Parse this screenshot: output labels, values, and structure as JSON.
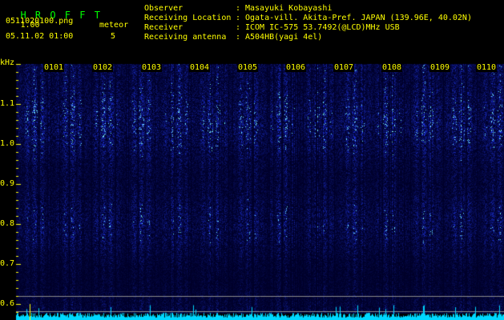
{
  "app": {
    "name": "H R O F F T",
    "version": "1.00"
  },
  "file": {
    "name": "0511020100.png",
    "datetime": "05.11.02 01:00"
  },
  "meteor": {
    "label": "meteor",
    "count": "5"
  },
  "info": [
    {
      "label": "Observer",
      "sep": ":",
      "value": "Masayuki Kobayashi"
    },
    {
      "label": "Receiving Location",
      "sep": ":",
      "value": "Ogata-vill. Akita-Pref. JAPAN (139.96E, 40.02N)"
    },
    {
      "label": "Receiver",
      "sep": ":",
      "value": "ICOM IC-575 53.7492(@LCD)MHz USB"
    },
    {
      "label": "Receiving antenna",
      "sep": ":",
      "value": "A504HB(yagi 4el)"
    }
  ],
  "y_axis": {
    "unit": "kHz",
    "ticks": [
      "1.1",
      "1.0",
      "0.9",
      "0.8",
      "0.7",
      "0.6"
    ]
  },
  "time_labels": [
    "0101",
    "0102",
    "0103",
    "0104",
    "0105",
    "0106",
    "0107",
    "0108",
    "0109",
    "0110"
  ],
  "colors": {
    "header_text": "#ffff00",
    "brand": "#00ff00",
    "signal": "#1a2cff",
    "trace": "#00e5ff"
  }
}
